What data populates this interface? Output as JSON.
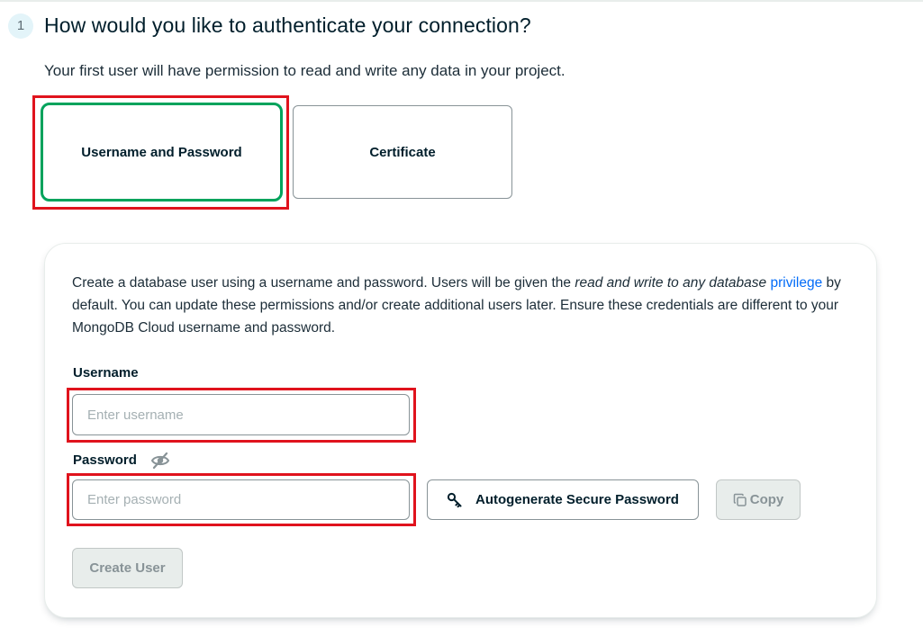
{
  "step": {
    "number": "1",
    "title": "How would you like to authenticate your connection?",
    "subtitle": "Your first user will have permission to read and write any data in your project."
  },
  "auth_options": [
    {
      "label": "Username and Password",
      "selected": true
    },
    {
      "label": "Certificate",
      "selected": false
    }
  ],
  "panel": {
    "desc_part1": "Create a database user using a username and password. Users will be given the ",
    "desc_emphasis": "read and write to any database",
    "desc_link": "privilege",
    "desc_part2": " by default. You can update these permissions and/or create additional users later. Ensure these credentials are different to your MongoDB Cloud username and password.",
    "username_label": "Username",
    "username_placeholder": "Enter username",
    "username_value": "",
    "password_label": "Password",
    "password_placeholder": "Enter password",
    "password_value": "",
    "password_visibility_icon": "eye-off-icon",
    "autogenerate_icon": "key-icon",
    "autogenerate_label": "Autogenerate Secure Password",
    "copy_icon": "copy-icon",
    "copy_label": "Copy",
    "create_label": "Create User"
  },
  "colors": {
    "accent_green": "#00a35c",
    "highlight_red": "#e0131d",
    "link_blue": "#016bf8",
    "disabled_bg": "#e8edeb",
    "disabled_text": "#889397"
  }
}
